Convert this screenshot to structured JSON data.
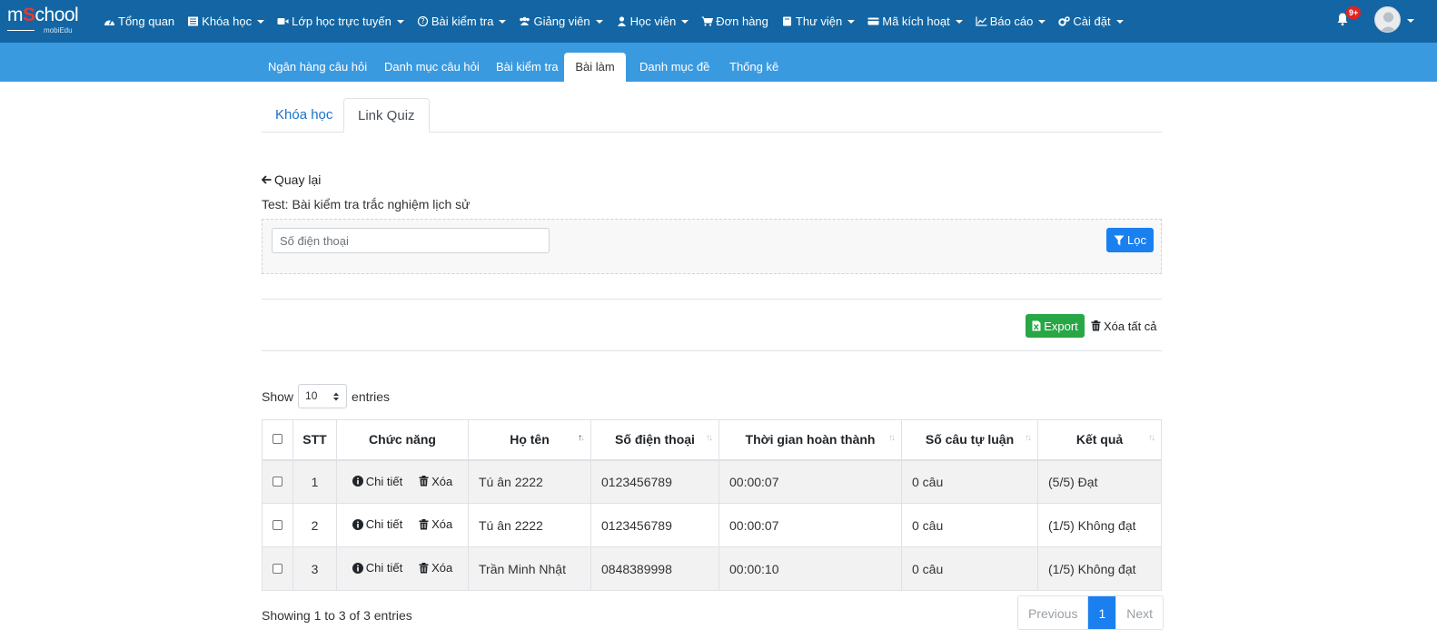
{
  "app": {
    "logo_text_prefix": "m",
    "logo_text_accent": "S",
    "logo_text_suffix": "chool",
    "logo_sub": "mobiEdu",
    "notification_count": "9+"
  },
  "nav": [
    {
      "label": "Tổng quan",
      "icon": "dashboard-icon",
      "caret": false
    },
    {
      "label": "Khóa học",
      "icon": "list-icon",
      "caret": true
    },
    {
      "label": "Lớp học trực tuyến",
      "icon": "video-icon",
      "caret": true
    },
    {
      "label": "Bài kiểm tra",
      "icon": "question-icon",
      "caret": true
    },
    {
      "label": "Giảng viên",
      "icon": "users-icon",
      "caret": true
    },
    {
      "label": "Học viên",
      "icon": "user-icon",
      "caret": true
    },
    {
      "label": "Đơn hàng",
      "icon": "cart-icon",
      "caret": false
    },
    {
      "label": "Thư viện",
      "icon": "book-icon",
      "caret": true
    },
    {
      "label": "Mã kích hoạt",
      "icon": "card-icon",
      "caret": true
    },
    {
      "label": "Báo cáo",
      "icon": "chart-icon",
      "caret": true
    },
    {
      "label": "Cài đặt",
      "icon": "gears-icon",
      "caret": true
    }
  ],
  "subtabs": [
    "Ngân hàng câu hỏi",
    "Danh mục câu hỏi",
    "Bài kiểm tra",
    "Bài làm",
    "Danh mục đề",
    "Thống kê"
  ],
  "active_subtab": "Bài làm",
  "inner_tabs": [
    "Khóa học",
    "Link Quiz"
  ],
  "back_label": "Quay lại",
  "test_label": "Test: Bài kiểm tra trắc nghiệm lịch sử",
  "filter": {
    "phone_placeholder": "Số điện thoại",
    "filter_button": "Lọc"
  },
  "actions": {
    "export": "Export",
    "delete_all": "Xóa tất cả"
  },
  "length": {
    "show": "Show",
    "value": "10",
    "entries": "entries"
  },
  "table": {
    "columns": [
      "STT",
      "Chức năng",
      "Họ tên",
      "Số điện thoại",
      "Thời gian hoàn thành",
      "Số câu tự luận",
      "Kết quả"
    ],
    "detail_label": "Chi tiết",
    "delete_label": "Xóa",
    "rows": [
      {
        "stt": "1",
        "name": "Tú ân 2222",
        "phone": "0123456789",
        "time": "00:00:07",
        "essay": "0 câu",
        "result": "(5/5) Đạt"
      },
      {
        "stt": "2",
        "name": "Tú ân 2222",
        "phone": "0123456789",
        "time": "00:00:07",
        "essay": "0 câu",
        "result": "(1/5) Không đạt"
      },
      {
        "stt": "3",
        "name": "Trần Minh Nhật",
        "phone": "0848389998",
        "time": "00:00:10",
        "essay": "0 câu",
        "result": "(1/5) Không đạt"
      }
    ]
  },
  "footer": {
    "info": "Showing 1 to 3 of 3 entries",
    "previous": "Previous",
    "page": "1",
    "next": "Next"
  },
  "colors": {
    "navbar": "#1366a3",
    "subbar": "#3a9ae0",
    "primary": "#1a80f0",
    "success": "#28a745"
  }
}
